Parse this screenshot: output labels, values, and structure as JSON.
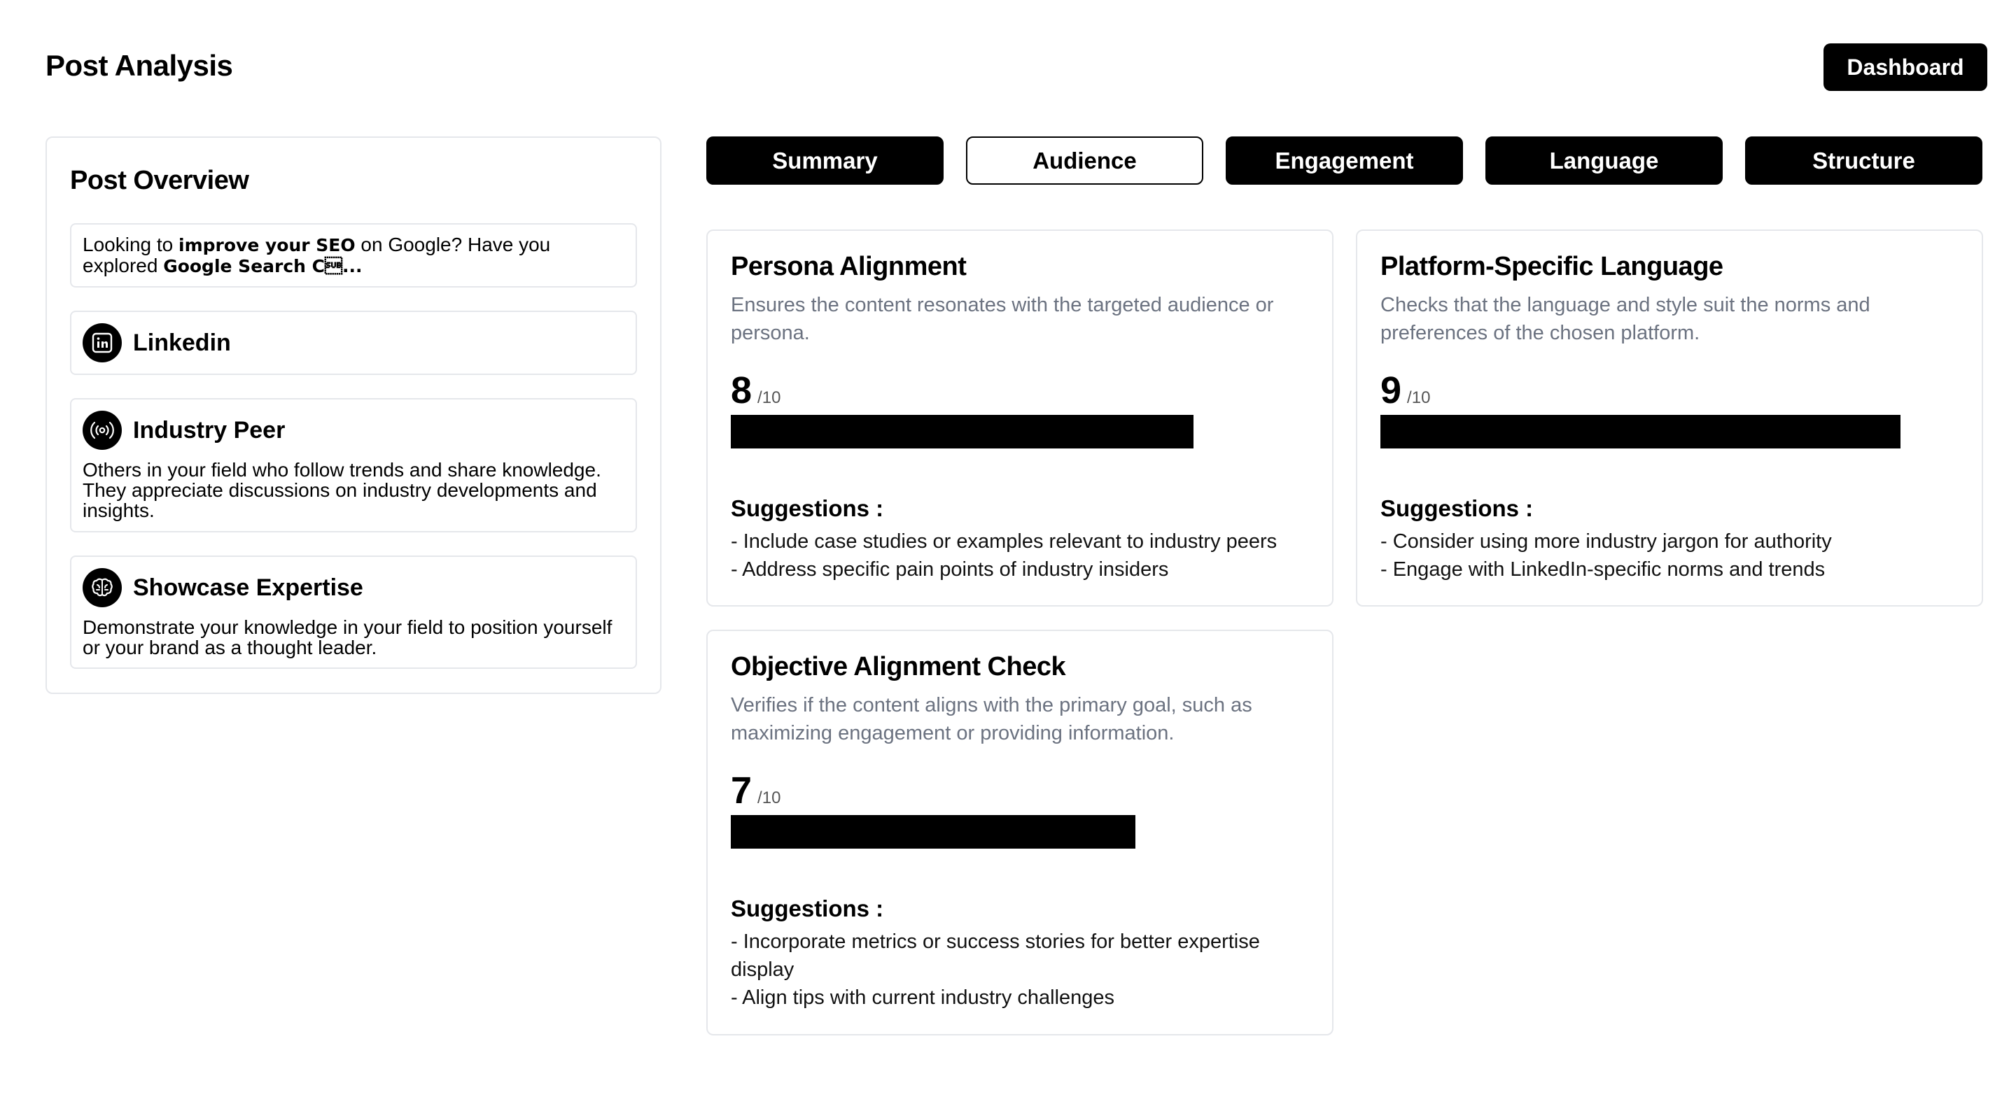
{
  "header": {
    "title": "Post Analysis",
    "dashboard_label": "Dashboard"
  },
  "overview": {
    "title": "Post Overview",
    "post_text_prefix": "Looking to ",
    "post_text_bold1": "improve your SEO",
    "post_text_mid": " on Google? Have you explored ",
    "post_text_bold2": "Google Search C\u001a...",
    "platform": {
      "label": "Linkedin",
      "icon": "linkedin-icon"
    },
    "persona": {
      "label": "Industry Peer",
      "icon": "broadcast-icon",
      "description": "Others in your field who follow trends and share knowledge. They appreciate discussions on industry developments and insights."
    },
    "objective": {
      "label": "Showcase Expertise",
      "icon": "brain-icon",
      "description": "Demonstrate your knowledge in your field to position yourself or your brand as a thought leader."
    }
  },
  "tabs": [
    {
      "label": "Summary",
      "active": false
    },
    {
      "label": "Audience",
      "active": true
    },
    {
      "label": "Engagement",
      "active": false
    },
    {
      "label": "Language",
      "active": false
    },
    {
      "label": "Structure",
      "active": false
    }
  ],
  "cards": [
    {
      "title": "Persona Alignment",
      "description": "Ensures the content resonates with the targeted audience or persona.",
      "score": "8",
      "score_max": "/10",
      "fill_fraction": 0.8,
      "suggestions_title": "Suggestions :",
      "suggestions": [
        "- Include case studies or examples relevant to industry peers",
        "- Address specific pain points of industry insiders"
      ]
    },
    {
      "title": "Platform-Specific Language",
      "description": "Checks that the language and style suit the norms and preferences of the chosen platform.",
      "score": "9",
      "score_max": "/10",
      "fill_fraction": 0.9,
      "suggestions_title": "Suggestions :",
      "suggestions": [
        "- Consider using more industry jargon for authority",
        "- Engage with LinkedIn-specific norms and trends"
      ]
    },
    {
      "title": "Objective Alignment Check",
      "description": "Verifies if the content aligns with the primary goal, such as maximizing engagement or providing information.",
      "score": "7",
      "score_max": "/10",
      "fill_fraction": 0.7,
      "suggestions_title": "Suggestions :",
      "suggestions": [
        "- Incorporate metrics or success stories for better expertise display",
        "- Align tips with current industry challenges"
      ]
    }
  ],
  "colors": {
    "accent": "#000000",
    "border": "#e5e7eb",
    "muted_text": "#6b7280"
  }
}
